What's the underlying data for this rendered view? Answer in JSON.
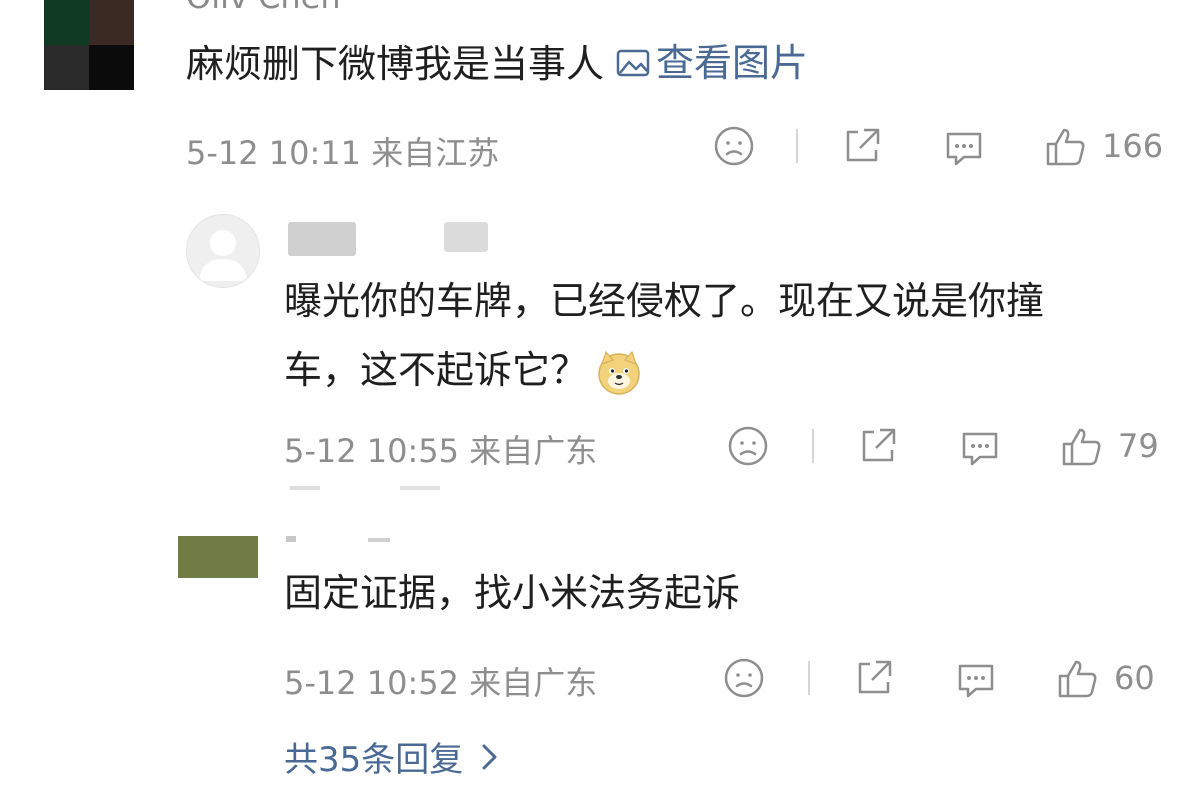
{
  "top_comment": {
    "username": "Oliv    Chen",
    "text": "麻烦删下微博我是当事人",
    "view_picture_label": "查看图片",
    "meta": "5-12 10:11  来自江苏",
    "like_count": "166"
  },
  "replies": [
    {
      "text_line1": "曝光你的车牌，已经侵权了。现在又说是你撞",
      "text_line2": "车，这不起诉它？",
      "emoji": "doge-emoji",
      "meta": "5-12 10:55  来自广东",
      "like_count": "79"
    },
    {
      "text": "固定证据，找小米法务起诉",
      "meta": "5-12 10:52  来自广东",
      "like_count": "60"
    }
  ],
  "more_replies_label": "共35条回复",
  "colors": {
    "link": "#4a6a94",
    "meta": "#8e8e8e",
    "text": "#1f1f1f"
  },
  "icons": [
    "sad-face-icon",
    "share-icon",
    "comment-icon",
    "thumbs-up-icon",
    "image-icon",
    "chevron-right-icon"
  ]
}
